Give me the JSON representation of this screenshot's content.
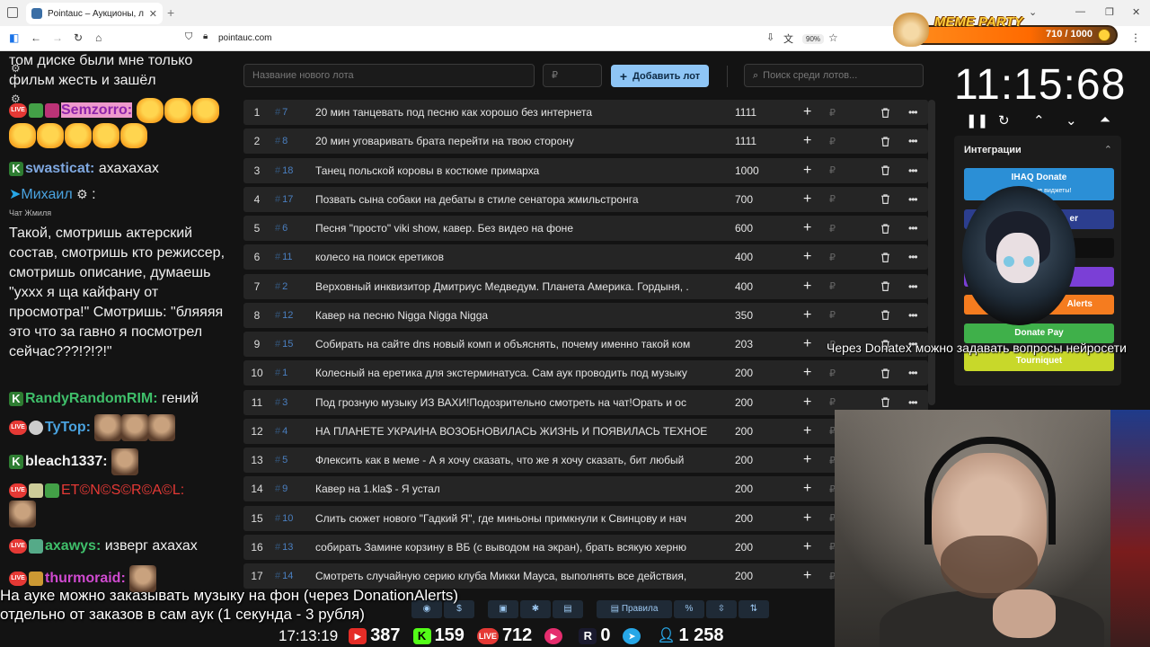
{
  "browser": {
    "tab_title": "Pointauc – Аукционы, лотереи",
    "url": "pointauc.com",
    "zoom": "90%"
  },
  "chat": {
    "lines": [
      {
        "text": "том диске были мне только"
      },
      {
        "text": "фильм жесть и зашёл"
      },
      {
        "nick": "Semzorro:",
        "nick_color": "#8e24aa"
      },
      {
        "nick": "swasticat:",
        "nick_color": "#7fa8e0",
        "text": "ахахахах"
      },
      {
        "nick": "Михаил",
        "nick_color": "#4aa3e0",
        "text": ":"
      },
      {
        "text": "Чат Жмиля"
      },
      {
        "text": "Такой, смотришь актерский состав, смотришь кто режиссер, смотришь описание, думаешь \"ухxх я ща кайфану от просмотра!\" Смотришь: \"бляяяя это что за гавно я посмотрел сейчас???!?!?!\""
      },
      {
        "nick": "RandyRandomRIM:",
        "nick_color": "#3fbf6a",
        "text": "гений"
      },
      {
        "nick": "TyTop:",
        "nick_color": "#4aa3e0"
      },
      {
        "nick": "bleach1337:",
        "nick_color": "#e8e8e8"
      },
      {
        "nick": "ЕТ©N©S©R©A©L:",
        "nick_color": "#e53935"
      },
      {
        "nick": "axawys:",
        "nick_color": "#3fbf6a",
        "text": "изверг ахахах"
      },
      {
        "nick": "thurmoraid:",
        "nick_color": "#d04ad0"
      }
    ]
  },
  "controls": {
    "new_lot_placeholder": "Название нового лота",
    "amount_placeholder": "₽",
    "add_button": "Добавить лот",
    "search_placeholder": "Поиск среди лотов..."
  },
  "lots": [
    {
      "num": "1",
      "id": "7",
      "name": "20 мин танцевать под песню как хорошо без интернета",
      "amount": "1111"
    },
    {
      "num": "2",
      "id": "8",
      "name": "20 мин уговаривать брата перейти на твою сторону",
      "amount": "1111"
    },
    {
      "num": "3",
      "id": "18",
      "name": "Танец польской коровы в костюме примарха",
      "amount": "1000"
    },
    {
      "num": "4",
      "id": "17",
      "name": "Позвать сына собаки на дебаты в стиле сенатора жмильстронга",
      "amount": "700"
    },
    {
      "num": "5",
      "id": "6",
      "name": "Песня \"просто\" viki show, кавер. Без видео на фоне",
      "amount": "600"
    },
    {
      "num": "6",
      "id": "11",
      "name": "колесо на поиск еретиков",
      "amount": "400"
    },
    {
      "num": "7",
      "id": "2",
      "name": "Верховный инквизитор Дмитриус Медведум. Планета Америка. Гордыня, .",
      "amount": "400"
    },
    {
      "num": "8",
      "id": "12",
      "name": "Кавер на песню Nigga Nigga Nigga",
      "amount": "350"
    },
    {
      "num": "9",
      "id": "15",
      "name": "Собирать на сайте dns новый комп и объяснять, почему именно такой ком",
      "amount": "203"
    },
    {
      "num": "10",
      "id": "1",
      "name": "Колесный на еретика для экстерминатуса. Сам аук проводить под музыку",
      "amount": "200"
    },
    {
      "num": "11",
      "id": "3",
      "name": "Под грозную музыку ИЗ ВАХИ!Подозрительно смотреть на чат!Орать и ос",
      "amount": "200"
    },
    {
      "num": "12",
      "id": "4",
      "name": "НА ПЛАНЕТЕ УКРАИНА ВОЗОБНОВИЛАСЬ ЖИЗНЬ И ПОЯВИЛАСЬ ТЕХНОЕ",
      "amount": "200"
    },
    {
      "num": "13",
      "id": "5",
      "name": "Флексить как в меме - А я хочу сказать, что же я хочу сказать, бит любый",
      "amount": "200"
    },
    {
      "num": "14",
      "id": "9",
      "name": "Кавер на 1.kla$ - Я устал",
      "amount": "200"
    },
    {
      "num": "15",
      "id": "10",
      "name": "Слить сюжет нового \"Гадкий Я\", где миньоны примкнули к Свинцову и нач",
      "amount": "200"
    },
    {
      "num": "16",
      "id": "13",
      "name": "собирать Замине корзину в ВБ (с выводом на экран), брать всякую херню",
      "amount": "200"
    },
    {
      "num": "17",
      "id": "14",
      "name": "Смотреть случайную серию клуба Микки Мауса, выполнять все действия,",
      "amount": "200"
    }
  ],
  "currency_symbol": "₽",
  "timer": "11:15:68",
  "integrations": {
    "header": "Интеграции",
    "ihaq_title": "IHAQ Donate",
    "ihaq_sub": "Уникальные виджеты!",
    "partial_label": "er",
    "alerts_label": "Alerts",
    "donatepay_label": "Donate Pay",
    "tourniquet_label": "Tourniquet"
  },
  "meme_party": {
    "title": "MEME PARTY",
    "counter": "710 / 1000"
  },
  "ticker_text": "Через Donatex можно задавать вопросы нейросети",
  "bottom_note": {
    "line1": "На ауке можно заказывать музыку на фон (через DonationAlerts)",
    "line2": "отдельно от заказов в сам аук (1 секунда - 3 рубля)"
  },
  "bottom_buttons": {
    "rules_label": "Правила"
  },
  "stats": {
    "clock": "17:13:19",
    "youtube": "387",
    "kick": "159",
    "vk_live": "712",
    "rutube": "0",
    "telegram": "",
    "viewers": "1 258"
  },
  "colors": {
    "accent": "#8ec5f5",
    "lot_id": "#4a7fc0",
    "row_bg": "#252525",
    "bg": "#131313"
  }
}
